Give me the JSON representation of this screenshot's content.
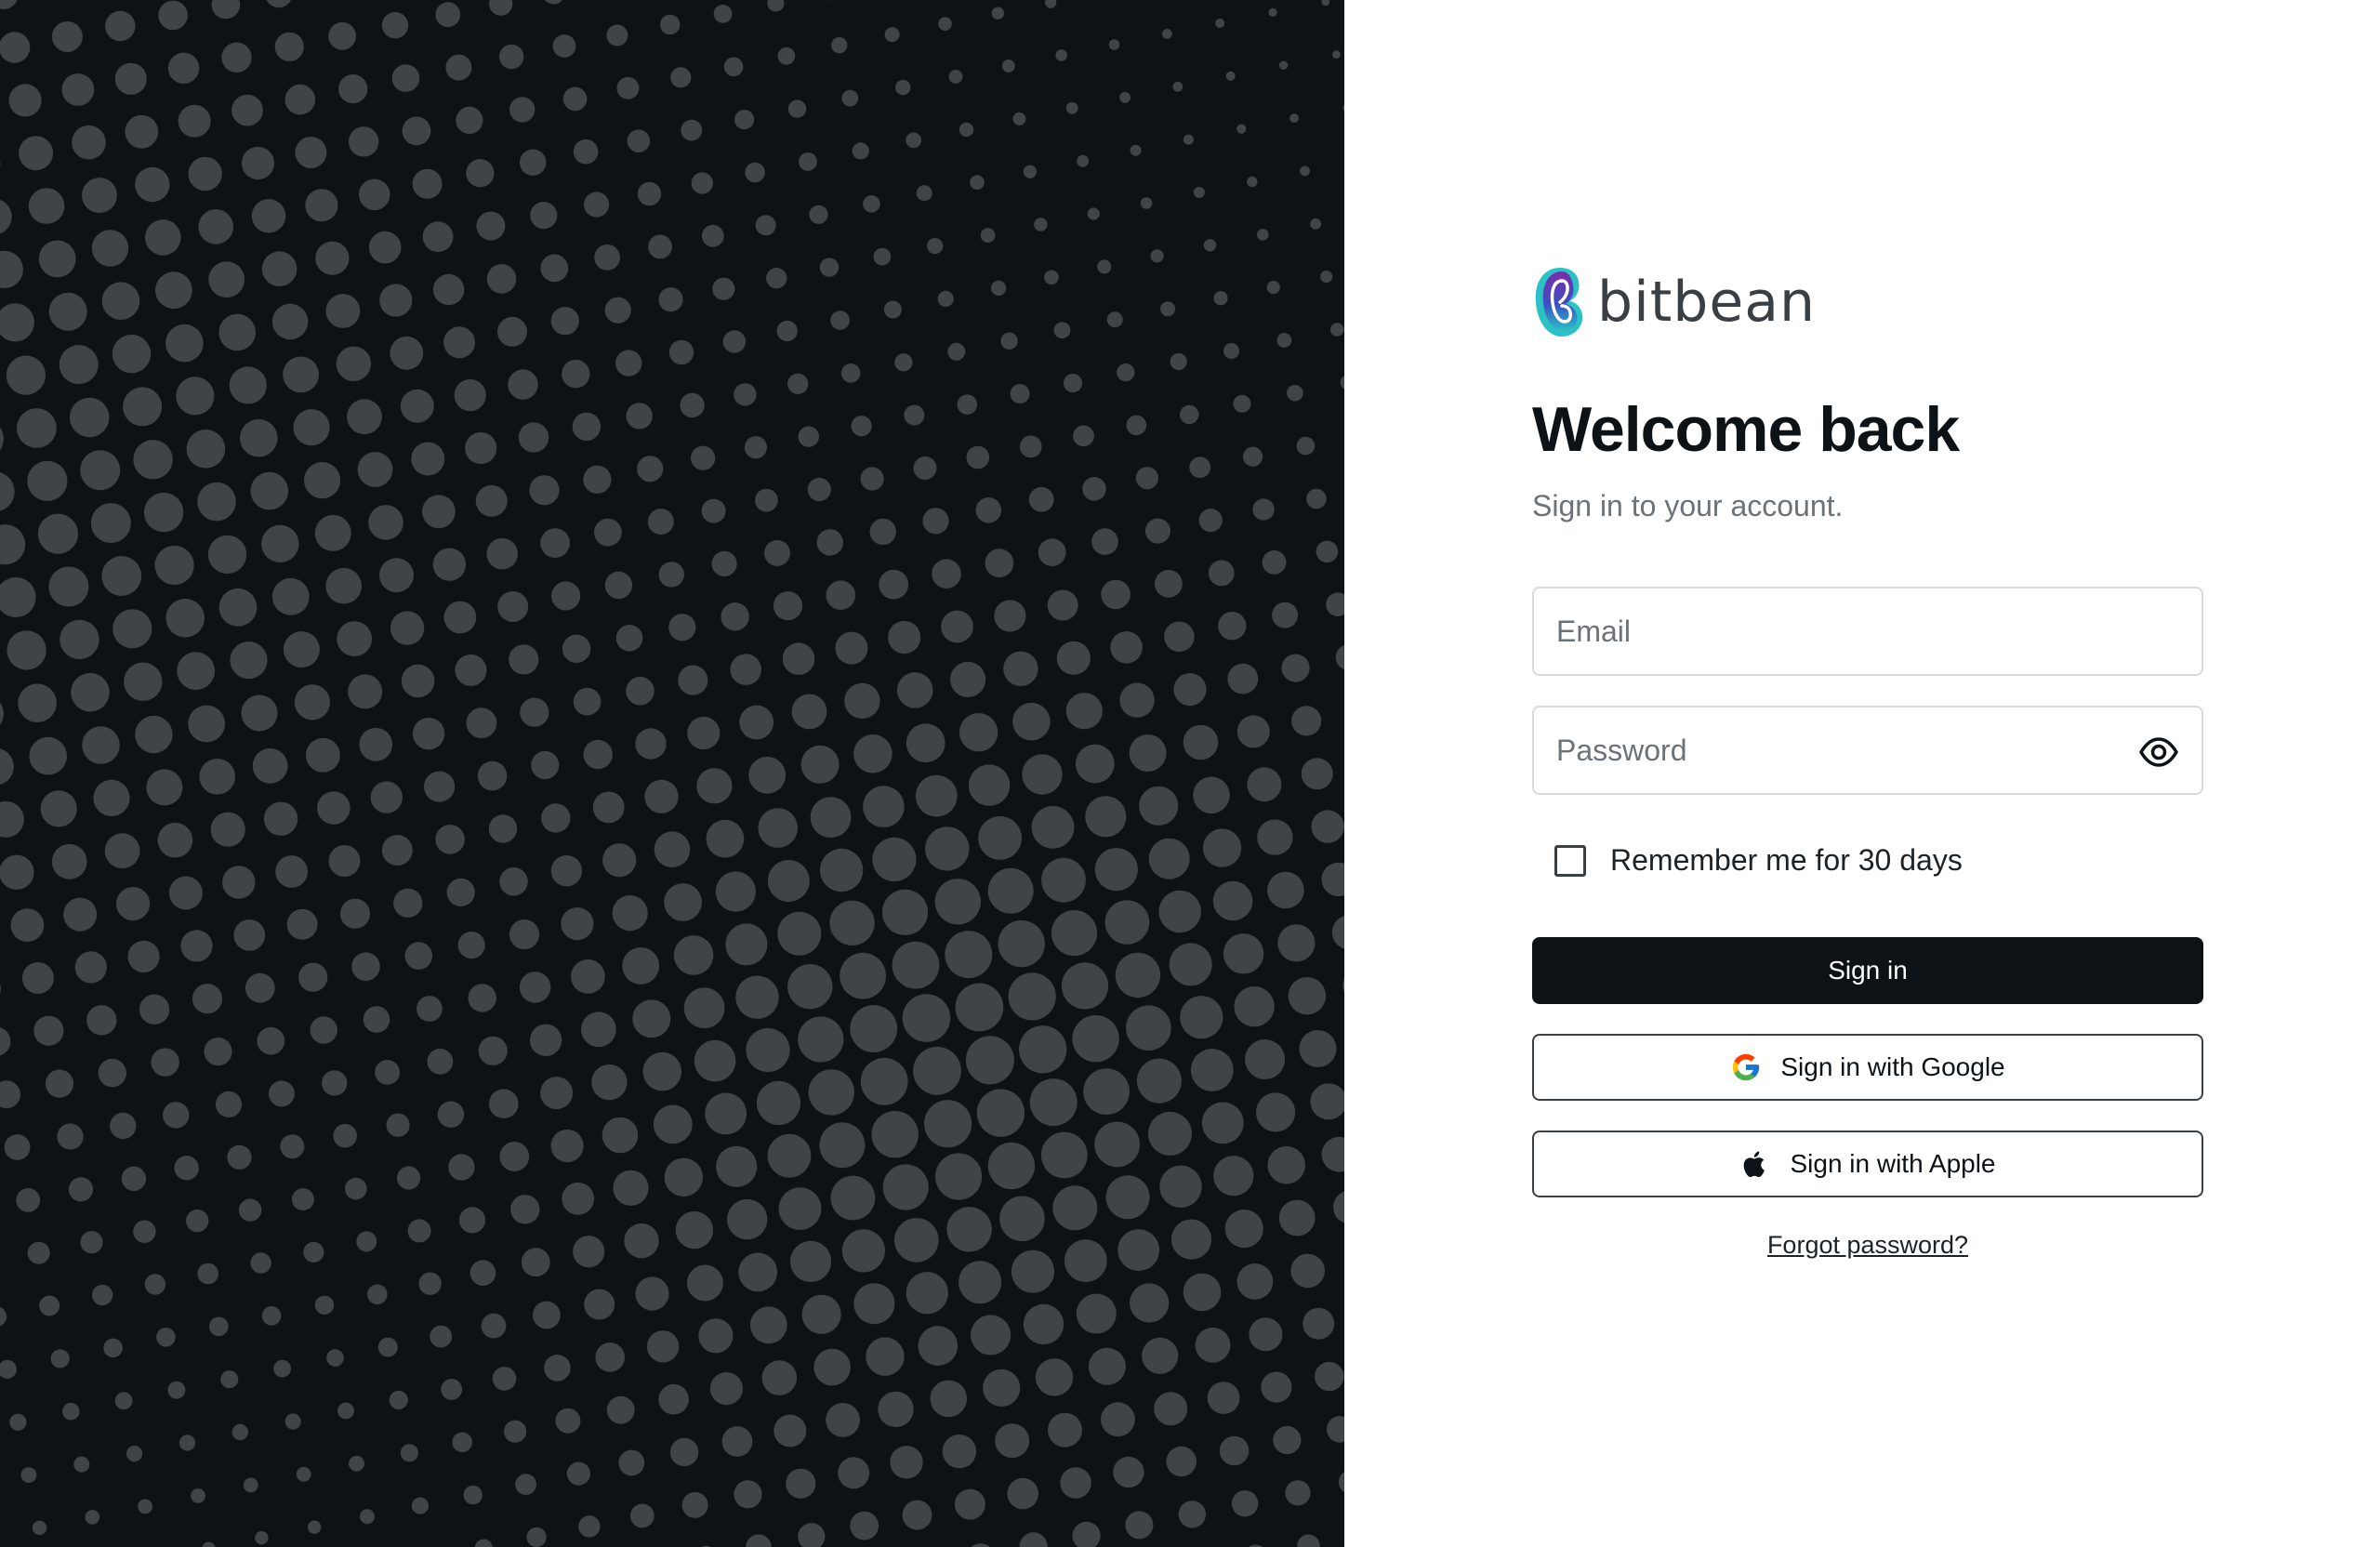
{
  "brand": {
    "name": "bitbean",
    "logo_icon": "bitbean-logo-icon"
  },
  "heading": {
    "title": "Welcome back",
    "subtitle": "Sign in to your account."
  },
  "form": {
    "email_placeholder": "Email",
    "password_placeholder": "Password",
    "remember_label": "Remember me for 30 days",
    "remember_checked": false,
    "sign_in_label": "Sign in",
    "google_label": "Sign in with Google",
    "apple_label": "Sign in with Apple",
    "forgot_label": "Forgot password?"
  },
  "icons": {
    "password_toggle": "eye-icon",
    "google": "google-icon",
    "apple": "apple-icon"
  },
  "colors": {
    "background_dark": "#0c1216",
    "dot_color": "#3e4448",
    "primary_button": "#0c1216",
    "text_primary": "#0c1216",
    "text_secondary": "#6b7278",
    "field_border": "#d7dbdf"
  }
}
